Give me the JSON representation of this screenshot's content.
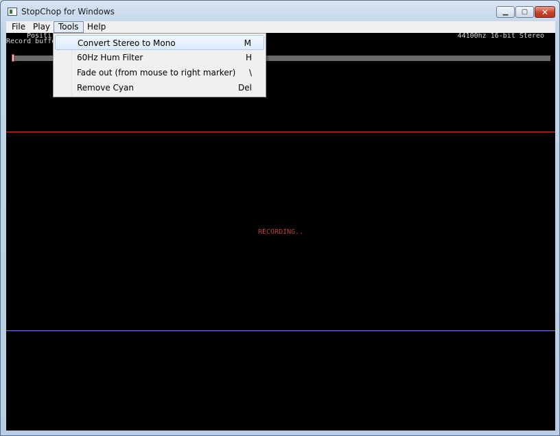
{
  "window": {
    "title": "StopChop for Windows"
  },
  "menubar": {
    "items": [
      "File",
      "Play",
      "Tools",
      "Help"
    ]
  },
  "tools_menu": {
    "items": [
      {
        "label": "Convert Stereo to Mono",
        "shortcut": "M"
      },
      {
        "label": "60Hz Hum Filter",
        "shortcut": "H"
      },
      {
        "label": "Fade out (from mouse to right marker)",
        "shortcut": "\\"
      },
      {
        "label": "Remove Cyan",
        "shortcut": "Del"
      }
    ]
  },
  "status": {
    "format": "44100hz 16-bit Stereo",
    "position_label": "Positi",
    "buffer_label": "Record buffe"
  },
  "canvas": {
    "recording_text": "RECORDING.."
  },
  "colors": {
    "waveform_bg": "#000000",
    "marker_line": "#e03030",
    "divider_line": "#8080ff",
    "recording_text": "#c04040"
  }
}
